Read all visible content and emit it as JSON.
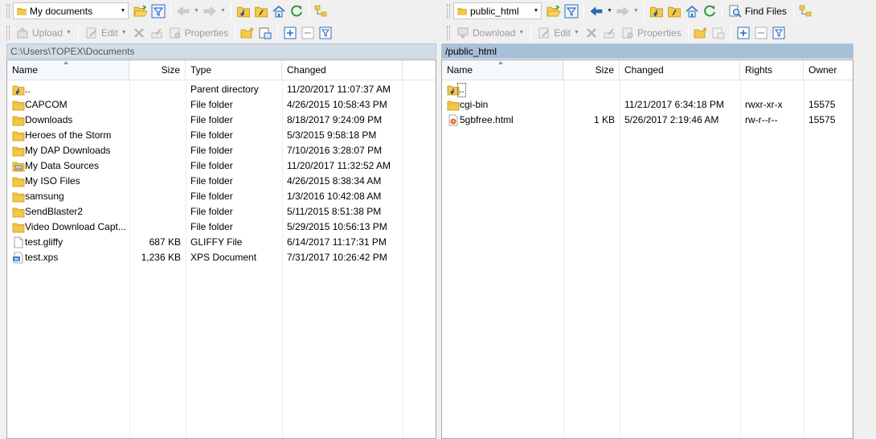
{
  "colors": {
    "folder": "#e8b830",
    "folder_dark": "#c8940c",
    "accent_blue": "#2a6ebc",
    "green": "#2f9a2f"
  },
  "left": {
    "location": {
      "value": "My documents",
      "icon": "folder-icon"
    },
    "toolbar2": {
      "upload": "Upload",
      "edit": "Edit",
      "properties": "Properties"
    },
    "path": "C:\\Users\\TOPEX\\Documents",
    "columns": [
      "Name",
      "Size",
      "Type",
      "Changed"
    ],
    "rows": [
      {
        "icon": "parent-dir-icon",
        "name": "..",
        "size": "",
        "type": "Parent directory",
        "changed": "11/20/2017  11:07:37 AM"
      },
      {
        "icon": "folder-icon",
        "name": "CAPCOM",
        "size": "",
        "type": "File folder",
        "changed": "4/26/2015  10:58:43 PM"
      },
      {
        "icon": "folder-icon",
        "name": "Downloads",
        "size": "",
        "type": "File folder",
        "changed": "8/18/2017  9:24:09 PM"
      },
      {
        "icon": "folder-icon",
        "name": "Heroes of the Storm",
        "size": "",
        "type": "File folder",
        "changed": "5/3/2015  9:58:18 PM"
      },
      {
        "icon": "folder-icon",
        "name": "My DAP Downloads",
        "size": "",
        "type": "File folder",
        "changed": "7/10/2016  3:28:07 PM"
      },
      {
        "icon": "data-sources-icon",
        "name": "My Data Sources",
        "size": "",
        "type": "File folder",
        "changed": "11/20/2017  11:32:52 AM"
      },
      {
        "icon": "folder-icon",
        "name": "My ISO Files",
        "size": "",
        "type": "File folder",
        "changed": "4/26/2015  8:38:34 AM"
      },
      {
        "icon": "folder-icon",
        "name": "samsung",
        "size": "",
        "type": "File folder",
        "changed": "1/3/2016  10:42:08 AM"
      },
      {
        "icon": "folder-icon",
        "name": "SendBlaster2",
        "size": "",
        "type": "File folder",
        "changed": "5/11/2015  8:51:38 PM"
      },
      {
        "icon": "folder-icon",
        "name": "Video Download Capt...",
        "size": "",
        "type": "File folder",
        "changed": "5/29/2015  10:56:13 PM"
      },
      {
        "icon": "generic-file-icon",
        "name": "test.gliffy",
        "size": "687 KB",
        "type": "GLIFFY File",
        "changed": "6/14/2017  11:17:31 PM"
      },
      {
        "icon": "xps-file-icon",
        "name": "test.xps",
        "size": "1,236 KB",
        "type": "XPS Document",
        "changed": "7/31/2017  10:26:42 PM"
      }
    ]
  },
  "right": {
    "location": {
      "value": "public_html",
      "icon": "folder-icon"
    },
    "find_files": "Find Files",
    "toolbar2": {
      "download": "Download",
      "edit": "Edit",
      "properties": "Properties"
    },
    "path": "/public_html",
    "columns": [
      "Name",
      "Size",
      "Changed",
      "Rights",
      "Owner"
    ],
    "rows": [
      {
        "icon": "parent-dir-icon",
        "name": "..",
        "size": "",
        "changed": "",
        "rights": "",
        "owner": ""
      },
      {
        "icon": "folder-icon",
        "name": "cgi-bin",
        "size": "",
        "changed": "11/21/2017 6:34:18 PM",
        "rights": "rwxr-xr-x",
        "owner": "15575"
      },
      {
        "icon": "html-file-icon",
        "name": "5gbfree.html",
        "size": "1 KB",
        "changed": "5/26/2017 2:19:46 AM",
        "rights": "rw-r--r--",
        "owner": "15575"
      }
    ]
  }
}
